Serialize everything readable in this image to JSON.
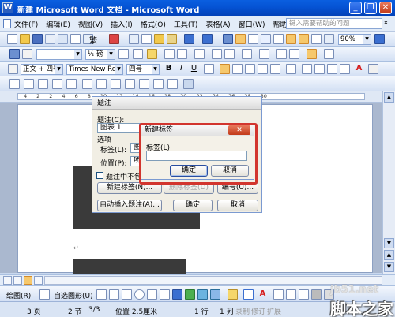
{
  "window": {
    "title": "新建 Microsoft Word 文档 - Microsoft Word",
    "minimize_glyph": "_",
    "restore_glyph": "❐",
    "close_glyph": "✕"
  },
  "menubar": {
    "items": [
      "文件(F)",
      "编辑(E)",
      "视图(V)",
      "插入(I)",
      "格式(O)",
      "工具(T)",
      "表格(A)",
      "窗口(W)",
      "帮助(H)"
    ],
    "help_placeholder": "键入需要帮助的问题",
    "close_doc_glyph": "×"
  },
  "standard_toolbar": {
    "fanti_label": "繁",
    "zoom": "90%",
    "read_label": "阅读(R)"
  },
  "drawing_line_toolbar": {
    "line_weight": "1 磅",
    "line_weight_alt": "½ 磅"
  },
  "formatting_toolbar": {
    "style": "正文 + 四号",
    "font": "Times New Roman",
    "size": "四号",
    "bold": "B",
    "italic": "I",
    "underline": "U",
    "font_color_letter": "A"
  },
  "ruler": {
    "numbers": [
      "4",
      "2",
      "2",
      "4",
      "6",
      "8",
      "10",
      "12",
      "14",
      "16",
      "18",
      "20",
      "22",
      "24",
      "26",
      "28",
      "30"
    ]
  },
  "caption_dialog": {
    "title": "题注",
    "caption_label": "题注(C):",
    "caption_value": "图表 1",
    "options_label": "选项",
    "label_label": "标签(L):",
    "label_value": "图",
    "position_label": "位置(P):",
    "position_value": "所",
    "exclude_label_checkbox": "题注中不包含",
    "new_label_button": "新建标签(N)...",
    "delete_label_button": "删除标签(D)",
    "numbering_button": "编号(U)...",
    "autocaption_button": "自动插入题注(A)...",
    "ok_button": "确定",
    "cancel_button": "取消"
  },
  "new_label_dialog": {
    "title": "新建标签",
    "close_glyph": "✕",
    "label_label": "标签(L):",
    "label_value": "",
    "ok_button": "确定",
    "cancel_button": "取消"
  },
  "drawing_toolbar": {
    "draw_label": "绘图(R)",
    "autoshapes_label": "自选图形(U)"
  },
  "statusbar": {
    "page": "3 页",
    "section": "2 节",
    "pages": "3/3",
    "position": "位置 2.5厘米",
    "line": "1 行",
    "column": "1 列",
    "rec": "录制",
    "trk": "修订",
    "ext": "扩展"
  },
  "watermark": {
    "domain": "jb51.net",
    "name": "脚本之家"
  },
  "colors": {
    "accent_red": "#d2352e",
    "title_blue": "#0553d4",
    "font_color_red": "#d62020"
  }
}
